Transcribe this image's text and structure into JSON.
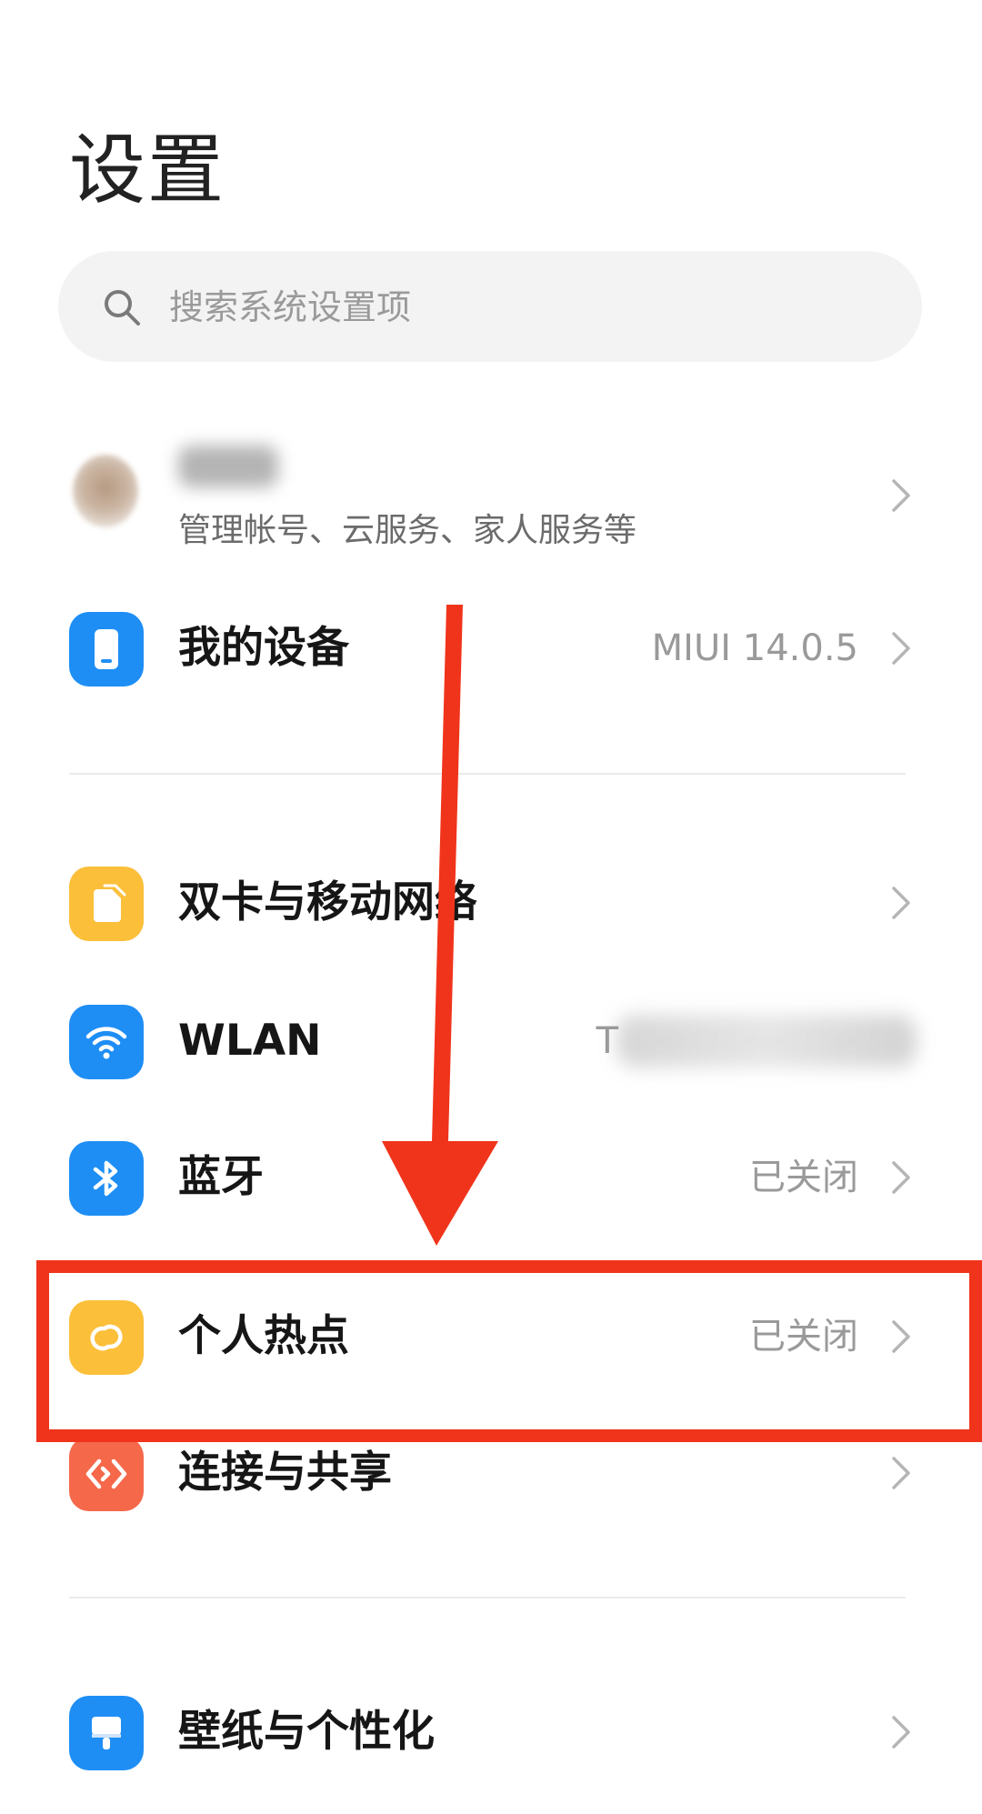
{
  "header": {
    "title": "设置"
  },
  "search": {
    "placeholder": "搜索系统设置项",
    "icon": "search-icon"
  },
  "account": {
    "subtitle": "管理帐号、云服务、家人服务等"
  },
  "rows": [
    {
      "id": "my-device",
      "label": "我的设备",
      "value": "MIUI 14.0.5",
      "icon": "phone-icon",
      "color": "#1e8ef5"
    },
    {
      "id": "dual-sim",
      "label": "双卡与移动网络",
      "value": "",
      "icon": "sim-card-icon",
      "color": "#fbbf3a"
    },
    {
      "id": "wlan",
      "label": "WLAN",
      "value": "T",
      "icon": "wifi-icon",
      "color": "#1e8ef5"
    },
    {
      "id": "bluetooth",
      "label": "蓝牙",
      "value": "已关闭",
      "icon": "bluetooth-icon",
      "color": "#1e8ef5"
    },
    {
      "id": "hotspot",
      "label": "个人热点",
      "value": "已关闭",
      "icon": "hotspot-icon",
      "color": "#fbbf3a"
    },
    {
      "id": "connection-sharing",
      "label": "连接与共享",
      "value": "",
      "icon": "share-icon",
      "color": "#f5684a"
    },
    {
      "id": "wallpaper",
      "label": "壁纸与个性化",
      "value": "",
      "icon": "brush-icon",
      "color": "#1e8ef5"
    }
  ],
  "annotation": {
    "color": "#f0341b"
  }
}
